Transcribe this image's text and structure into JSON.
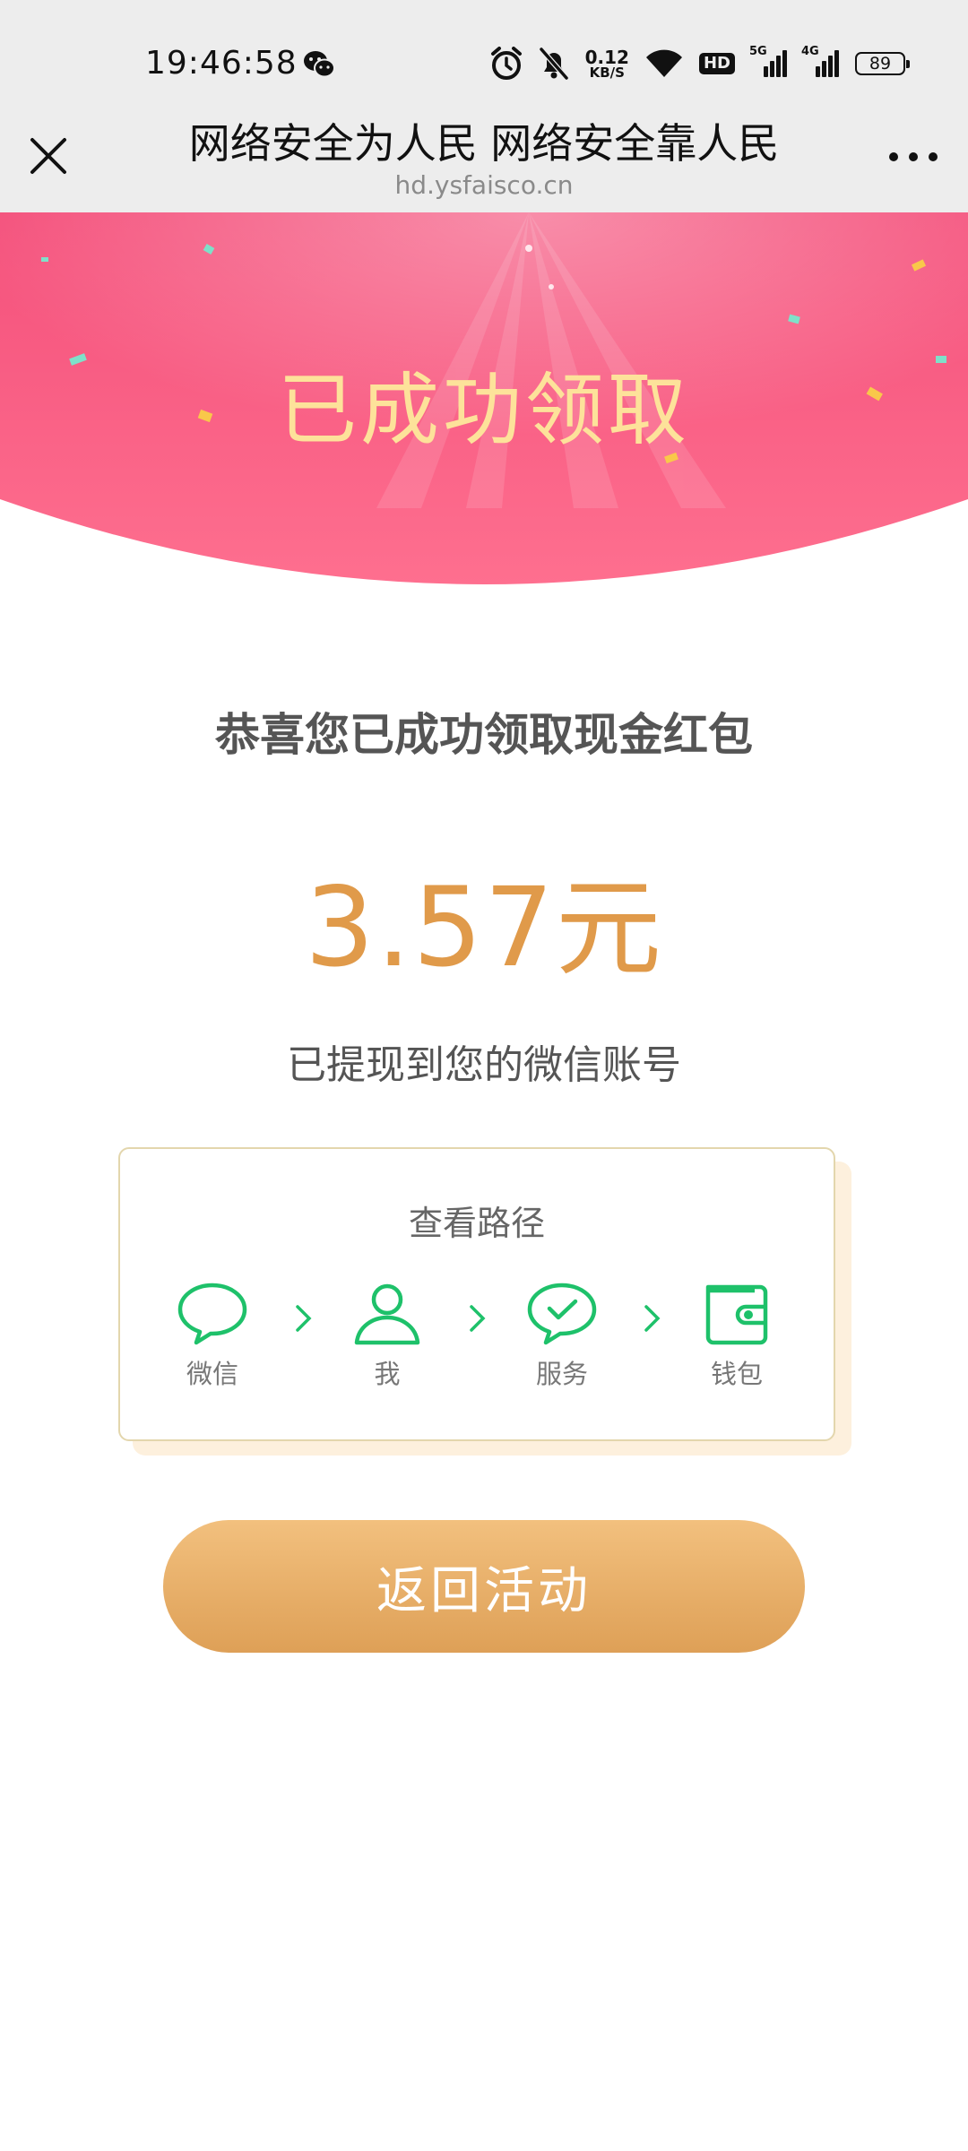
{
  "status_bar": {
    "time": "19:46:58",
    "net_speed_value": "0.12",
    "net_speed_unit": "KB/S",
    "hd_label": "HD",
    "sim1_tag": "5G",
    "sim2_tag": "4G",
    "battery": "89"
  },
  "nav": {
    "title": "网络安全为人民 网络安全靠人民",
    "url": "hd.ysfaisco.cn"
  },
  "banner": {
    "title": "已成功领取",
    "colors": {
      "top": "#f4507b",
      "bottom": "#fe6f8f",
      "title": "#fde29a"
    }
  },
  "result": {
    "congrats": "恭喜您已成功领取现金红包",
    "amount": "3.57",
    "unit": "元",
    "withdrawn_note": "已提现到您的微信账号"
  },
  "path_card": {
    "title": "查看路径",
    "steps": [
      {
        "label": "微信",
        "icon": "chat-bubble-icon"
      },
      {
        "label": "我",
        "icon": "person-icon"
      },
      {
        "label": "服务",
        "icon": "check-bubble-icon"
      },
      {
        "label": "钱包",
        "icon": "wallet-icon"
      }
    ],
    "icon_color": "#1ec16a"
  },
  "button": {
    "return_label": "返回活动",
    "color": "#e6aa62"
  }
}
